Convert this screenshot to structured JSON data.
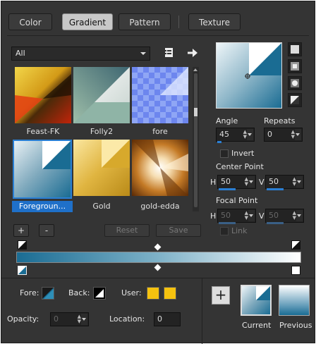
{
  "tabs": [
    {
      "label": "Color"
    },
    {
      "label": "Gradient"
    },
    {
      "label": "Pattern"
    },
    {
      "label": "Texture"
    }
  ],
  "category": {
    "value": "All"
  },
  "gradients": [
    {
      "name": "Feast-FK"
    },
    {
      "name": "Folly2"
    },
    {
      "name": "fore"
    },
    {
      "name": "Foregroun..."
    },
    {
      "name": "Gold"
    },
    {
      "name": "gold-edda"
    }
  ],
  "list_buttons": {
    "add": "+",
    "remove": "-",
    "reset": "Reset",
    "save": "Save"
  },
  "angle": {
    "label": "Angle",
    "value": "45"
  },
  "repeats": {
    "label": "Repeats",
    "value": "0"
  },
  "invert": {
    "label": "Invert",
    "checked": false
  },
  "center_point": {
    "label": "Center Point",
    "h_label": "H",
    "h": "50",
    "v_label": "V",
    "v": "50"
  },
  "focal_point": {
    "label": "Focal Point",
    "h_label": "H",
    "h": "50",
    "v_label": "V",
    "v": "50"
  },
  "link": {
    "label": "Link"
  },
  "fore": {
    "label": "Fore:"
  },
  "back": {
    "label": "Back:"
  },
  "user": {
    "label": "User:"
  },
  "opacity": {
    "label": "Opacity:",
    "value": "0"
  },
  "location": {
    "label": "Location:",
    "value": "0"
  },
  "current_label": "Current",
  "previous_label": "Previous",
  "add_swatch": "+",
  "colors": {
    "accent": "#2a7fd4",
    "gradient_dark": "#1a6c93",
    "gradient_light": "#ffffff",
    "user_yellow": "#f5c20f"
  }
}
